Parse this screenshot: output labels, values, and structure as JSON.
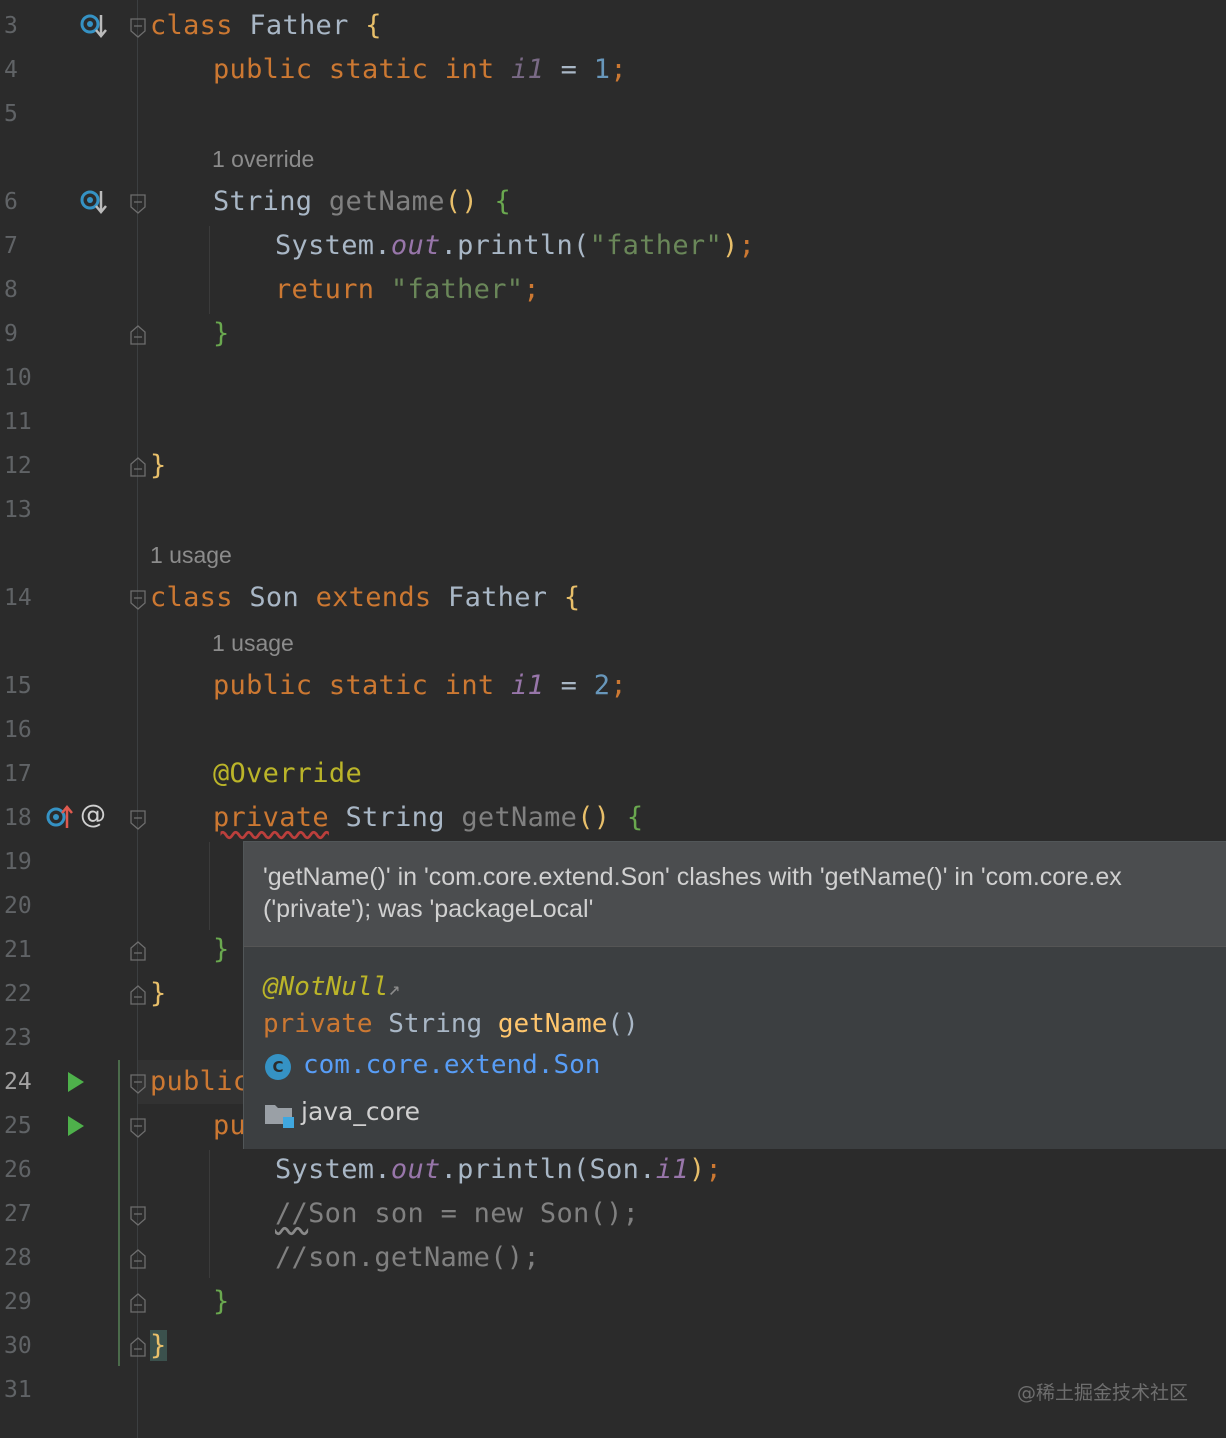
{
  "lines": {
    "l3": {
      "num": "3",
      "t1": "class",
      "t2": " Father ",
      "t3": "{"
    },
    "l4": {
      "num": "4",
      "t1": "public static int ",
      "t2": "i1",
      "t3": " = ",
      "t4": "1",
      "t5": ";"
    },
    "l5": {
      "num": "5"
    },
    "h5": {
      "text": "1 override"
    },
    "l6": {
      "num": "6",
      "t1": "String ",
      "t2": "getName",
      "t3": "()",
      "t4": " {"
    },
    "l7": {
      "num": "7",
      "t1": "System.",
      "t2": "out",
      "t3": ".println(",
      "t4": "\"father\"",
      "t5": ")",
      "t6": ";"
    },
    "l8": {
      "num": "8",
      "t1": "return ",
      "t2": "\"father\"",
      "t3": ";"
    },
    "l9": {
      "num": "9",
      "t1": "}"
    },
    "l10": {
      "num": "10"
    },
    "l11": {
      "num": "11"
    },
    "l12": {
      "num": "12",
      "t1": "}"
    },
    "l13": {
      "num": "13"
    },
    "h13": {
      "text": "1 usage"
    },
    "l14": {
      "num": "14",
      "t1": "class",
      "t2": " Son ",
      "t3": "extends",
      "t4": " Father ",
      "t5": "{"
    },
    "h14": {
      "text": "1 usage"
    },
    "l15": {
      "num": "15",
      "t1": "public static int ",
      "t2": "i1",
      "t3": " = ",
      "t4": "2",
      "t5": ";"
    },
    "l16": {
      "num": "16"
    },
    "l17": {
      "num": "17",
      "t1": "@Override"
    },
    "l18": {
      "num": "18",
      "t1": "private",
      "t2": " String ",
      "t3": "getName",
      "t4": "()",
      "t5": " {"
    },
    "l19": {
      "num": "19"
    },
    "l20": {
      "num": "20"
    },
    "l21": {
      "num": "21",
      "t1": "}"
    },
    "l22": {
      "num": "22",
      "t1": "}"
    },
    "l23": {
      "num": "23"
    },
    "l24": {
      "num": "24",
      "t1": "public"
    },
    "l25": {
      "num": "25",
      "t1": "pu"
    },
    "l26": {
      "num": "26",
      "t1": "System.",
      "t2": "out",
      "t3": ".println(Son.",
      "t4": "i1",
      "t5": ")",
      "t6": ";"
    },
    "l27": {
      "num": "27",
      "t1": "//",
      "t2": "Son son = new Son();"
    },
    "l28": {
      "num": "28",
      "t1": "//son.getName();"
    },
    "l29": {
      "num": "29",
      "t1": "}"
    },
    "l30": {
      "num": "30",
      "t1": "}"
    },
    "l31": {
      "num": "31"
    }
  },
  "gutter_icons": {
    "l3": "override-down-icon",
    "l6": "override-down-icon",
    "l18": [
      "overrides-up-icon",
      "at-annotation-icon"
    ],
    "l24": "run-icon",
    "l25": "run-icon"
  },
  "popup": {
    "error_line1": "'getName()' in 'com.core.extend.Son' clashes with 'getName()' in 'com.core.ex",
    "error_line2": "('private'); was 'packageLocal'",
    "annotation": "@NotNull",
    "annotation_link": "↗",
    "sig_kw": "private",
    "sig_type": " String ",
    "sig_name": "getName",
    "sig_paren": "()",
    "class_badge": "C",
    "class_name": "com.core.extend.Son",
    "module_name": "java_core"
  },
  "watermark": "@稀土掘金技术社区",
  "colors": {
    "background": "#2b2b2b",
    "keyword": "#cc7832",
    "string": "#6a8759",
    "number": "#6897bb",
    "static_field": "#9876aa",
    "annotation": "#bbb529",
    "popup_bg": "#3c3f41",
    "run_green": "#4eb14b"
  }
}
